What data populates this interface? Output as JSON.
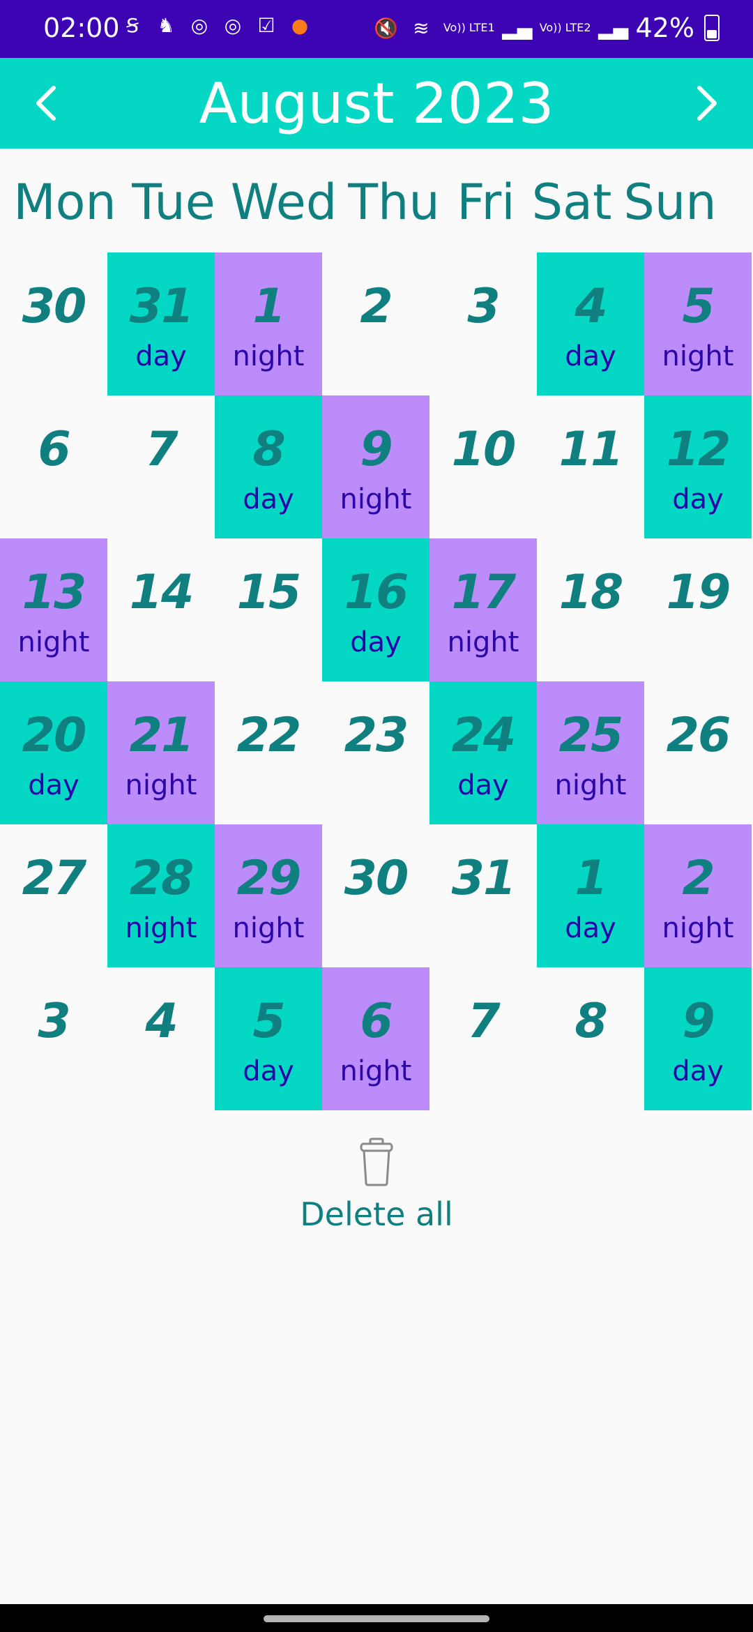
{
  "status_bar": {
    "time": "02:00",
    "battery": "42%",
    "net1": "Vo)) LTE1",
    "net2": "Vo)) LTE2"
  },
  "header": {
    "title": "August 2023",
    "prev_icon": "chevron-left-icon",
    "next_icon": "chevron-right-icon"
  },
  "weekdays": [
    "Mon",
    "Tue",
    "Wed",
    "Thu",
    "Fri",
    "Sat",
    "Sun"
  ],
  "shift_colors": {
    "day": "#04d8c4",
    "night": "#bd8cfb"
  },
  "calendar": {
    "weeks": [
      [
        {
          "d": "30",
          "s": ""
        },
        {
          "d": "31",
          "s": "day"
        },
        {
          "d": "1",
          "s": "night"
        },
        {
          "d": "2",
          "s": ""
        },
        {
          "d": "3",
          "s": ""
        },
        {
          "d": "4",
          "s": "day"
        },
        {
          "d": "5",
          "s": "night"
        }
      ],
      [
        {
          "d": "6",
          "s": ""
        },
        {
          "d": "7",
          "s": ""
        },
        {
          "d": "8",
          "s": "day"
        },
        {
          "d": "9",
          "s": "night"
        },
        {
          "d": "10",
          "s": ""
        },
        {
          "d": "11",
          "s": ""
        },
        {
          "d": "12",
          "s": "day"
        }
      ],
      [
        {
          "d": "13",
          "s": "night"
        },
        {
          "d": "14",
          "s": ""
        },
        {
          "d": "15",
          "s": ""
        },
        {
          "d": "16",
          "s": "day"
        },
        {
          "d": "17",
          "s": "night"
        },
        {
          "d": "18",
          "s": ""
        },
        {
          "d": "19",
          "s": ""
        }
      ],
      [
        {
          "d": "20",
          "s": "day"
        },
        {
          "d": "21",
          "s": "night"
        },
        {
          "d": "22",
          "s": ""
        },
        {
          "d": "23",
          "s": ""
        },
        {
          "d": "24",
          "s": "day"
        },
        {
          "d": "25",
          "s": "night"
        },
        {
          "d": "26",
          "s": ""
        }
      ],
      [
        {
          "d": "27",
          "s": ""
        },
        {
          "d": "28",
          "s": "night",
          "c": "day"
        },
        {
          "d": "29",
          "s": "night"
        },
        {
          "d": "30",
          "s": ""
        },
        {
          "d": "31",
          "s": ""
        },
        {
          "d": "1",
          "s": "day"
        },
        {
          "d": "2",
          "s": "night"
        }
      ],
      [
        {
          "d": "3",
          "s": ""
        },
        {
          "d": "4",
          "s": ""
        },
        {
          "d": "5",
          "s": "day"
        },
        {
          "d": "6",
          "s": "night"
        },
        {
          "d": "7",
          "s": ""
        },
        {
          "d": "8",
          "s": ""
        },
        {
          "d": "9",
          "s": "day"
        }
      ]
    ]
  },
  "actions": {
    "delete_all_label": "Delete all",
    "delete_icon": "trash-icon"
  }
}
